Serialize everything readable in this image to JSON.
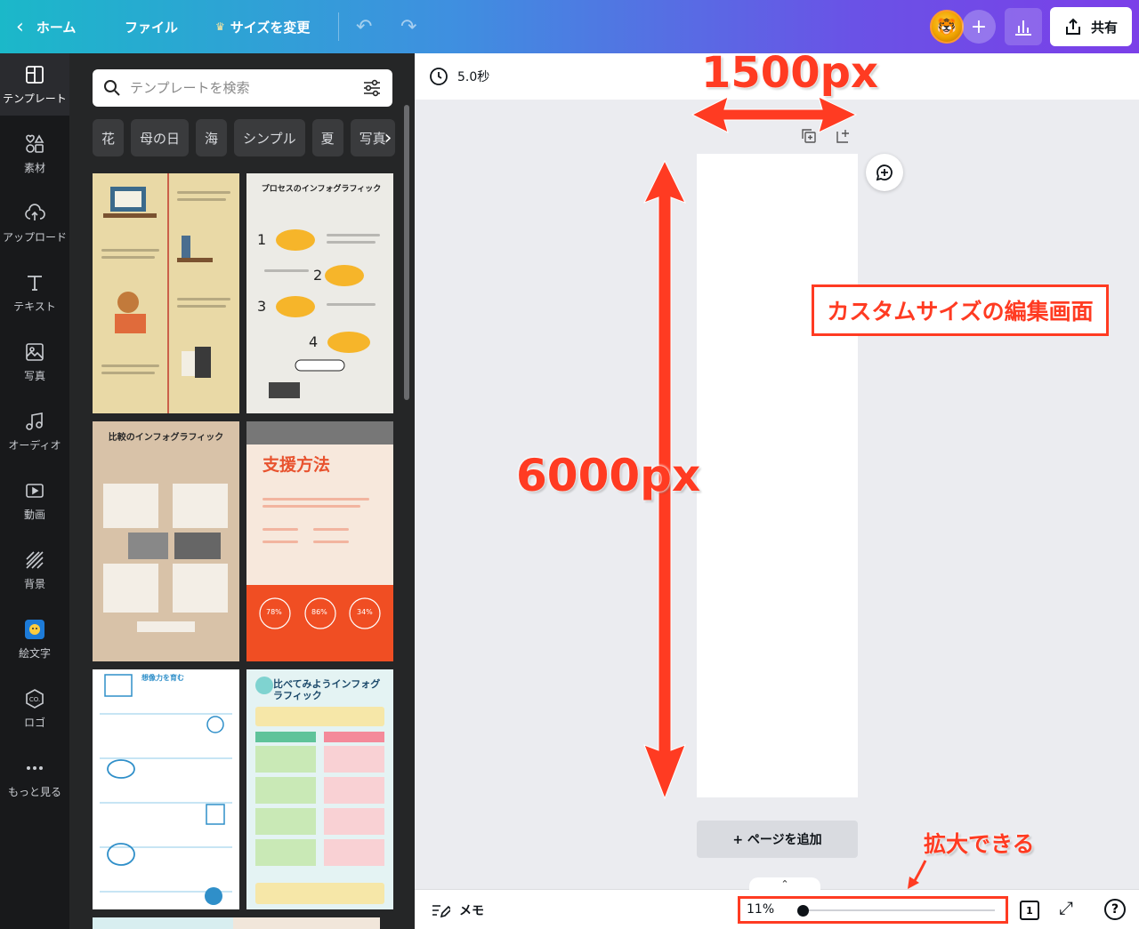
{
  "topbar": {
    "home_label": "ホーム",
    "file_label": "ファイル",
    "resize_label": "サイズを変更",
    "share_label": "共有"
  },
  "rail": {
    "items": [
      {
        "label": "テンプレート",
        "icon": "template-icon"
      },
      {
        "label": "素材",
        "icon": "elements-icon"
      },
      {
        "label": "アップロード",
        "icon": "upload-icon"
      },
      {
        "label": "テキスト",
        "icon": "text-icon"
      },
      {
        "label": "写真",
        "icon": "photo-icon"
      },
      {
        "label": "オーディオ",
        "icon": "audio-icon"
      },
      {
        "label": "動画",
        "icon": "video-icon"
      },
      {
        "label": "背景",
        "icon": "background-icon"
      },
      {
        "label": "絵文字",
        "icon": "emoji-icon"
      },
      {
        "label": "ロゴ",
        "icon": "logo-icon"
      },
      {
        "label": "もっと見る",
        "icon": "more-icon"
      }
    ]
  },
  "panel": {
    "search_placeholder": "テンプレートを検索",
    "chips": [
      "花",
      "母の日",
      "海",
      "シンプル",
      "夏",
      "写真"
    ],
    "templates": [
      {
        "title": "",
        "bg": "#e9d9a6"
      },
      {
        "title": "プロセスのインフォグラフィック",
        "bg": "#ecebe6"
      },
      {
        "title": "比較のインフォグラフィック",
        "bg": "#d8c2a8"
      },
      {
        "title": "支援方法",
        "bg": "#f7e8dc"
      },
      {
        "title": "想像力を育む",
        "bg": "#ffffff"
      },
      {
        "title": "比べてみようインフォグラフィック",
        "bg": "#e4f3f3"
      }
    ],
    "template_stats": [
      "78%",
      "86%",
      "34%"
    ]
  },
  "canvas": {
    "duration": "5.0秒",
    "add_page_label": "+ ページを追加"
  },
  "bottombar": {
    "memo_label": "メモ",
    "zoom_percent": "11%",
    "zoom_level": 0.0,
    "page_number": "1",
    "help_label": "?"
  },
  "annotations": {
    "width_label": "1500px",
    "height_label": "6000px",
    "custom_size_label": "カスタムサイズの編集画面",
    "zoom_label": "拡大できる"
  },
  "colors": {
    "annotation": "#ff3b22",
    "rail_bg": "#18191b",
    "panel_bg": "#252627"
  }
}
